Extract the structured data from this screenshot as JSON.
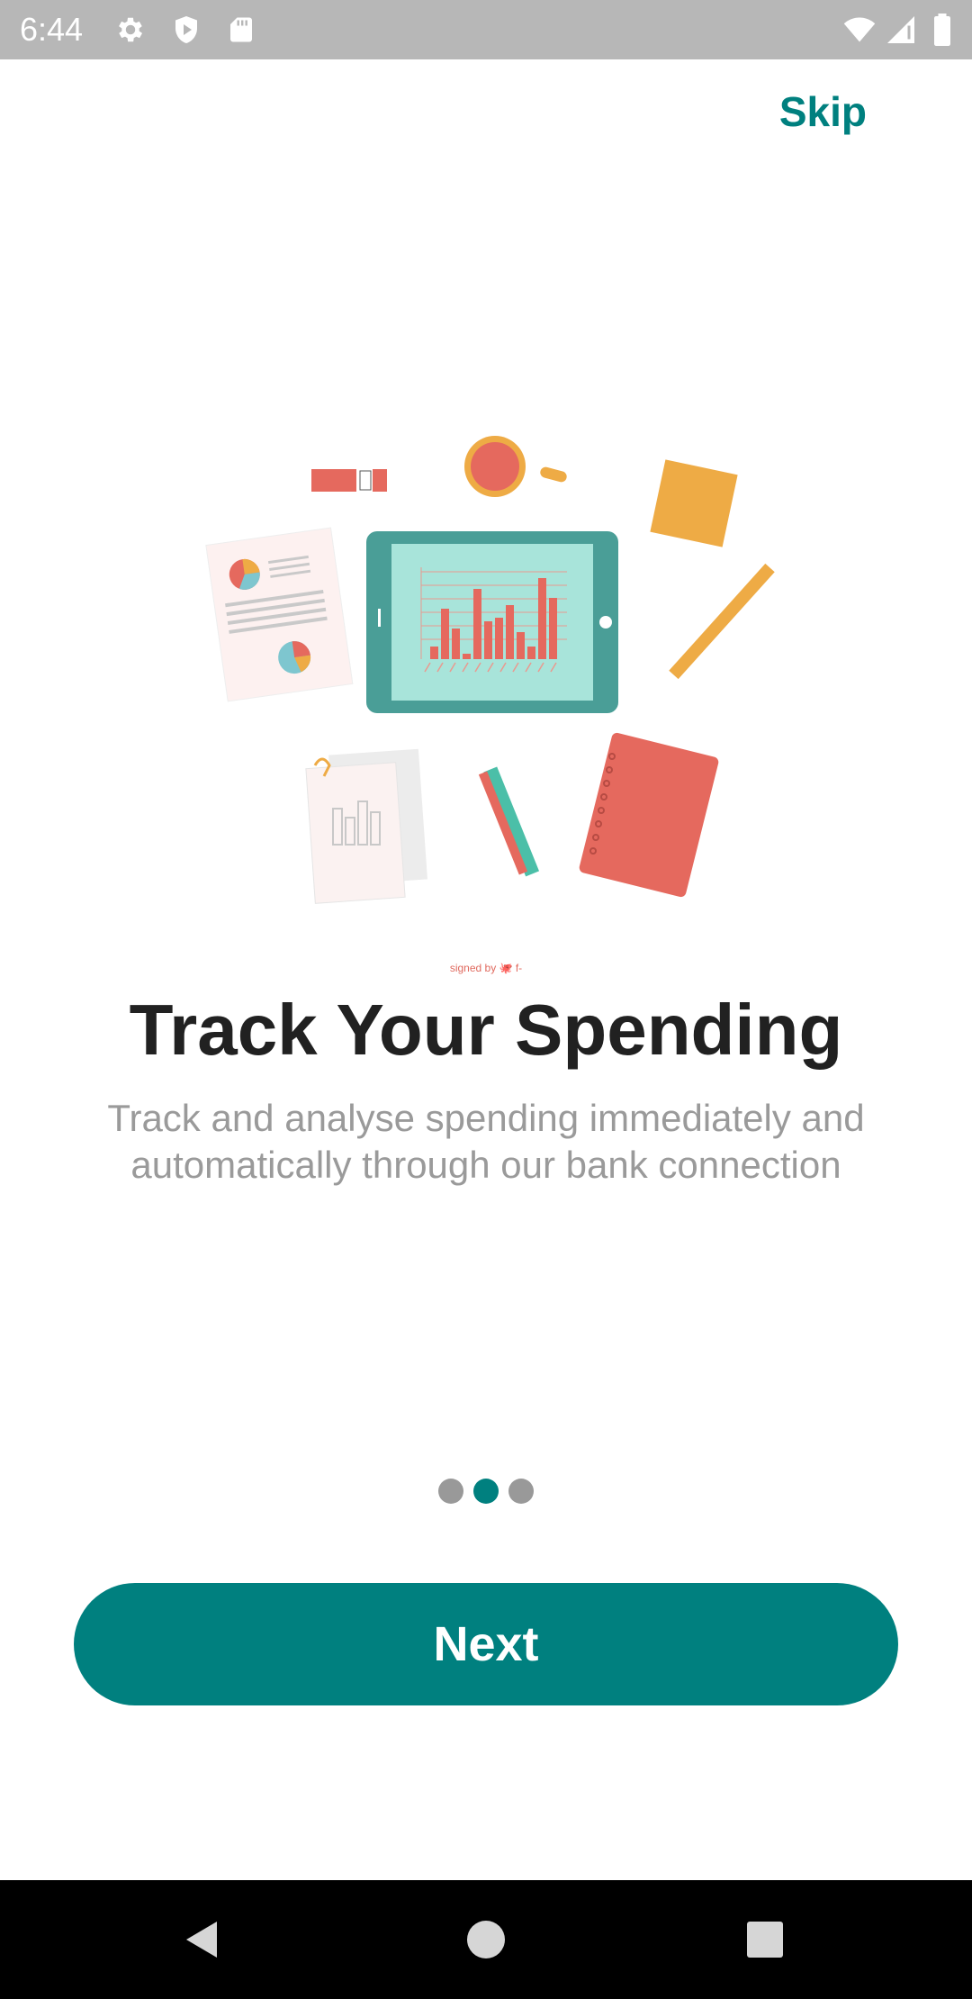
{
  "status_bar": {
    "time": "6:44",
    "left_icons": [
      "gear-icon",
      "shield-icon",
      "sd-card-icon"
    ],
    "right_icons": [
      "wifi-icon",
      "cell-signal-icon",
      "battery-icon"
    ]
  },
  "header": {
    "skip_label": "Skip"
  },
  "illustration": {
    "description_icon": "desk-finance-illustration",
    "credit_text": "signed by 🐙 f-"
  },
  "content": {
    "title": "Track Your Spending",
    "subtitle": "Track and analyse spending immediately and automatically through our bank connection"
  },
  "pager": {
    "total": 3,
    "active_index": 1
  },
  "actions": {
    "next_label": "Next"
  },
  "nav_bar": {
    "buttons": [
      "back-icon",
      "home-icon",
      "recents-icon"
    ]
  },
  "colors": {
    "accent": "#00807f",
    "status_bar": "#b7b7b7",
    "title": "#212121",
    "subtitle": "#9a9a9a",
    "dot_inactive": "#999999"
  }
}
